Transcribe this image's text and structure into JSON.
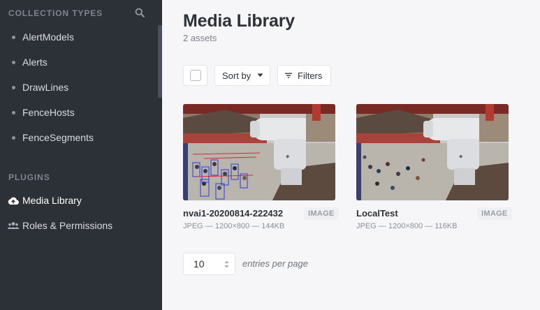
{
  "sidebar": {
    "collection_types_heading": "COLLECTION TYPES",
    "collection_items": [
      {
        "label": "AlertModels"
      },
      {
        "label": "Alerts"
      },
      {
        "label": "DrawLines"
      },
      {
        "label": "FenceHosts"
      },
      {
        "label": "FenceSegments"
      }
    ],
    "plugins_heading": "PLUGINS",
    "plugin_items": [
      {
        "label": "Media Library",
        "icon": "cloud-upload-icon",
        "active": true
      },
      {
        "label": "Roles & Permissions",
        "icon": "users-icon",
        "active": false
      }
    ],
    "search_icon": "search-icon"
  },
  "main": {
    "title": "Media Library",
    "subtitle": "2 assets",
    "toolbar": {
      "sort_label": "Sort by",
      "filters_label": "Filters"
    },
    "assets": [
      {
        "name": "nvai1-20200814-222432",
        "meta": "JPEG — 1200×800 — 144KB",
        "type": "IMAGE"
      },
      {
        "name": "LocalTest",
        "meta": "JPEG — 1200×800 — 116KB",
        "type": "IMAGE"
      }
    ],
    "pagination": {
      "per_page_value": "10",
      "per_page_label": "entries per page"
    }
  },
  "colors": {
    "sidebar_bg": "#2c3138",
    "main_bg": "#f6f6f9",
    "accent": "#4945ff"
  }
}
